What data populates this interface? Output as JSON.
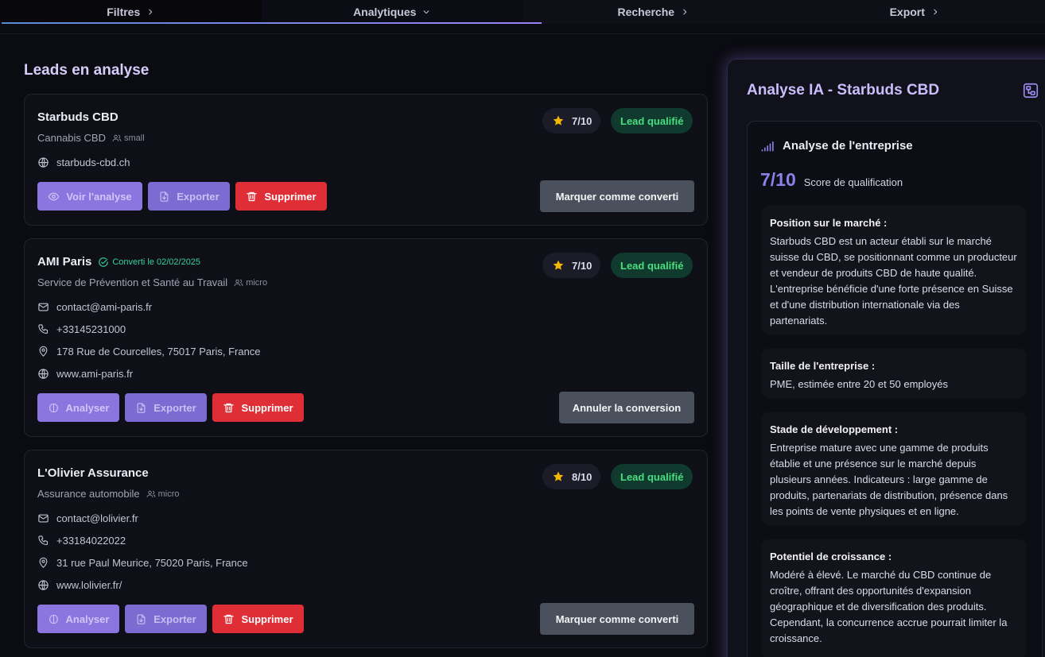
{
  "tabs": [
    {
      "label": "Filtres",
      "chevron": "chevron-right"
    },
    {
      "label": "Analytiques",
      "chevron": "chevron-down"
    },
    {
      "label": "Recherche",
      "chevron": "chevron-right"
    },
    {
      "label": "Export",
      "chevron": "chevron-right"
    }
  ],
  "left": {
    "title": "Leads en analyse",
    "leads": [
      {
        "name": "Starbuds CBD",
        "converted": "",
        "sector": "Cannabis CBD",
        "size": "small",
        "email": "",
        "phone": "",
        "address": "",
        "website": "starbuds-cbd.ch",
        "score": "7/10",
        "status": "Lead qualifié",
        "analyze_label": "Voir l'analyse",
        "export_label": "Exporter",
        "delete_label": "Supprimer",
        "action_label": "Marquer comme converti"
      },
      {
        "name": "AMI Paris",
        "converted": "Converti le 02/02/2025",
        "sector": "Service de Prévention et Santé au Travail",
        "size": "micro",
        "email": "contact@ami-paris.fr",
        "phone": "+33145231000",
        "address": "178 Rue de Courcelles, 75017 Paris, France",
        "website": "www.ami-paris.fr",
        "score": "7/10",
        "status": "Lead qualifié",
        "analyze_label": "Analyser",
        "export_label": "Exporter",
        "delete_label": "Supprimer",
        "action_label": "Annuler la conversion"
      },
      {
        "name": "L'Olivier Assurance",
        "converted": "",
        "sector": "Assurance automobile",
        "size": "micro",
        "email": "contact@lolivier.fr",
        "phone": "+33184022022",
        "address": "31 rue Paul Meurice, 75020 Paris, France",
        "website": "www.lolivier.fr/",
        "score": "8/10",
        "status": "Lead qualifié",
        "analyze_label": "Analyser",
        "export_label": "Exporter",
        "delete_label": "Supprimer",
        "action_label": "Marquer comme converti"
      }
    ]
  },
  "right": {
    "title": "Analyse IA - Starbuds CBD",
    "section_title": "Analyse de l'entreprise",
    "score": "7/10",
    "score_label": "Score de qualification",
    "blocks": [
      {
        "title": "Position sur le marché :",
        "text": "Starbuds CBD est un acteur établi sur le marché suisse du CBD, se positionnant comme un producteur et vendeur de produits CBD de haute qualité. L'entreprise bénéficie d'une forte présence en Suisse et d'une distribution internationale via des partenariats."
      },
      {
        "title": "Taille de l'entreprise :",
        "text": "PME, estimée entre 20 et 50 employés"
      },
      {
        "title": "Stade de développement :",
        "text": "Entreprise mature avec une gamme de produits établie et une présence sur le marché depuis plusieurs années. Indicateurs : large gamme de produits, partenariats de distribution, présence dans les points de vente physiques et en ligne."
      },
      {
        "title": "Potentiel de croissance :",
        "text": "Modéré à élevé. Le marché du CBD continue de croître, offrant des opportunités d'expansion géographique et de diversification des produits. Cependant, la concurrence accrue pourrait limiter la croissance."
      }
    ]
  },
  "colors": {
    "accent": "#8b76e0",
    "danger": "#e02e37",
    "success": "#4ade80",
    "star": "#f5b800"
  }
}
